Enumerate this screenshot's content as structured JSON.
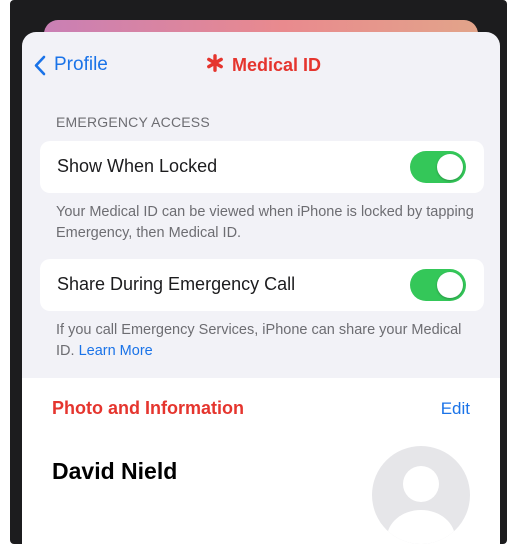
{
  "nav": {
    "back_label": "Profile",
    "title": "Medical ID"
  },
  "emergency_access": {
    "section_label": "EMERGENCY ACCESS",
    "show_when_locked": {
      "label": "Show When Locked",
      "enabled": true,
      "footnote": "Your Medical ID can be viewed when iPhone is locked by tapping Emergency, then Medical ID."
    },
    "share_during_call": {
      "label": "Share During Emergency Call",
      "enabled": true,
      "footnote_text": "If you call Emergency Services, iPhone can share your Medical ID.",
      "footnote_link": "Learn More"
    }
  },
  "photo_info": {
    "heading": "Photo and Information",
    "edit_label": "Edit",
    "name": "David Nield"
  },
  "colors": {
    "accent_blue": "#1a73e8",
    "medical_red": "#e5352e",
    "toggle_green": "#34c759",
    "grouped_background": "#f2f2f7"
  },
  "icons": [
    "chevron-left-icon",
    "medical-asterisk-icon",
    "person-silhouette-icon"
  ]
}
